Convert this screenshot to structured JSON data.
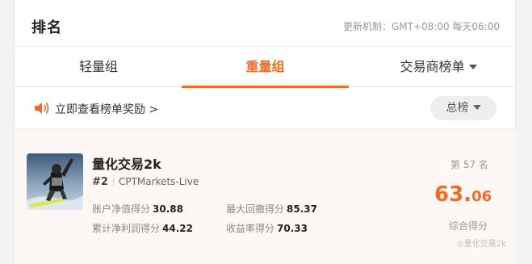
{
  "header": {
    "title": "排名",
    "update_info": "更新机制：GMT+08:00 每天06:00"
  },
  "tabs": [
    {
      "label": "轻量组",
      "active": false
    },
    {
      "label": "重量组",
      "active": true
    },
    {
      "label": "交易商榜单",
      "active": false
    }
  ],
  "rewards": {
    "link_label": "立即查看榜单奖励 >",
    "filter_label": "总榜"
  },
  "entry": {
    "name": "量化交易2k",
    "rank": "#2",
    "account": "CPTMarkets-Live",
    "stats": [
      {
        "label": "账户净值得分",
        "value": "30.88"
      },
      {
        "label": "最大回撤得分",
        "value": "85.37"
      },
      {
        "label": "累计净利润得分",
        "value": "44.22"
      },
      {
        "label": "收益率得分",
        "value": "70.33"
      }
    ],
    "place": "第 57 名",
    "score_int": "63.",
    "score_dec": "06",
    "score_label": "综合得分"
  },
  "watermark": "◎量化交易2k",
  "colors": {
    "accent": "#f26b22"
  }
}
